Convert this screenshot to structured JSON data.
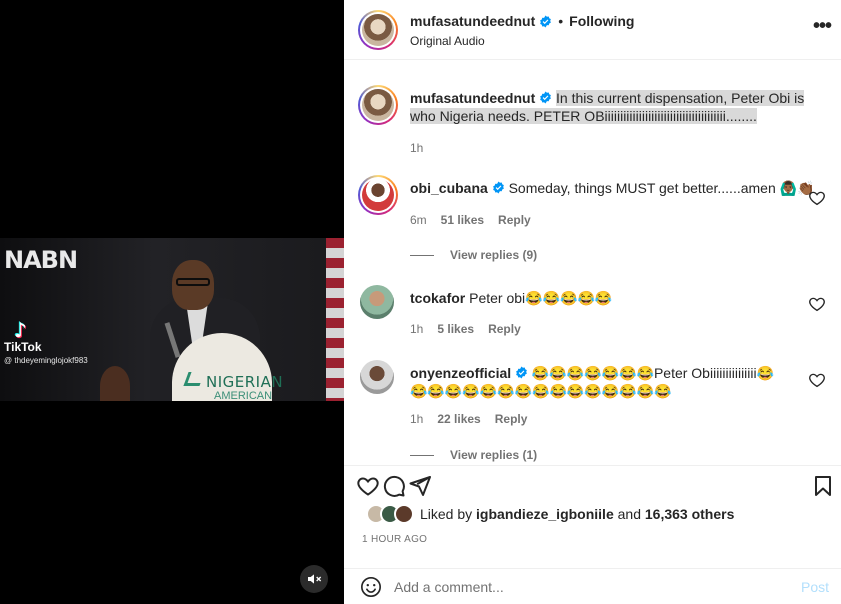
{
  "video": {
    "tiktok_brand": "TikTok",
    "tiktok_handle": "@ thdeyeminglojokf983",
    "logo_text": "NABN",
    "podium_text": "NIGERIAN",
    "podium_text2": "AMERICAN"
  },
  "header": {
    "username": "mufasatundeednut",
    "separator": "•",
    "follow_state": "Following",
    "audio": "Original Audio",
    "more_label": "•••"
  },
  "caption": {
    "username": "mufasatundeednut",
    "text": "In this current dispensation, Peter Obi is who Nigeria needs. PETER OBiiiiiiiiiiiiiiiiiiiiiiiiiiiiiiiiiiiiiii........",
    "time": "1h"
  },
  "comments": [
    {
      "username": "obi_cubana",
      "verified": true,
      "text": "Someday, things MUST get better......amen 🙆🏾‍♂️👏🏾",
      "time": "6m",
      "likes": "51 likes",
      "reply": "Reply",
      "view_replies": "View replies (9)"
    },
    {
      "username": "tcokafor",
      "verified": false,
      "text": "Peter obi😂😂😂😂😂",
      "time": "1h",
      "likes": "5 likes",
      "reply": "Reply"
    },
    {
      "username": "onyenzeofficial",
      "verified": true,
      "text": "😂😂😂😂😂😂😂Peter Obiiiiiiiiiiiiiii😂😂😂😂😂😂😂😂😂😂😂😂😂😂😂😂",
      "time": "1h",
      "likes": "22 likes",
      "reply": "Reply",
      "view_replies": "View replies (1)"
    }
  ],
  "likes": {
    "liked_by_prefix": "Liked by",
    "top_liker": "igbandieze_igboniile",
    "and_text": "and",
    "others": "16,363 others"
  },
  "post_time": "1 HOUR AGO",
  "comment_box": {
    "placeholder": "Add a comment...",
    "post_label": "Post"
  },
  "colors": {
    "verified": "#0095f6",
    "post_disabled": "#b2dffc",
    "muted_text": "#737373"
  }
}
